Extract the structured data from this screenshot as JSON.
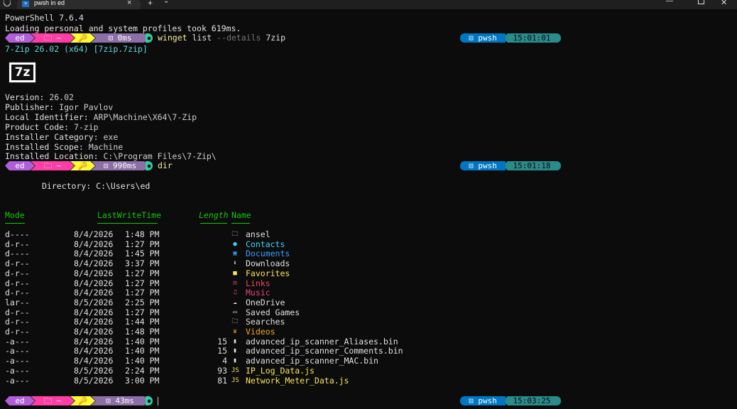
{
  "window": {
    "tab_title": "pwsh in ed",
    "tab_icon": "powershell-icon",
    "close_glyph": "×",
    "new_tab_glyph": "+",
    "dropdown_glyph": "⌄",
    "minimize_glyph": "—",
    "close_window_glyph": "✕"
  },
  "banner": {
    "version_line": "PowerShell 7.6.4",
    "profile_line": "Loading personal and system profiles took 619ms."
  },
  "prompts": [
    {
      "user": "ed",
      "path": "🗀 ~",
      "git": "🔑",
      "duration": "⊡ 0ms",
      "end_glyph": "●",
      "command_name": "winget",
      "command_args": " list ",
      "command_flag": "--details",
      "command_value": " 7zip",
      "shell": "⊡ pwsh",
      "clock": "15:01:01"
    },
    {
      "user": "ed",
      "path": "🗀 ~",
      "git": "🔑",
      "duration": "⊡ 990ms",
      "end_glyph": "●",
      "command_name": "dir",
      "command_args": "",
      "command_flag": "",
      "command_value": "",
      "shell": "⊡ pwsh",
      "clock": "15:01:18"
    },
    {
      "user": "ed",
      "path": "🗀 ~",
      "git": "🔑",
      "duration": "⊡ 43ms",
      "end_glyph": "●",
      "command_name": "",
      "command_args": "",
      "command_flag": "",
      "command_value": "",
      "shell": "⊡ pwsh",
      "clock": "15:03:25"
    }
  ],
  "winget": {
    "package_line": "7-Zip 26.02 (x64) [7zip.7zip]",
    "logo_text": "7z",
    "details": [
      {
        "key": "Version:",
        "value": " 26.02"
      },
      {
        "key": "Publisher:",
        "value": " Igor Pavlov"
      },
      {
        "key": "Local Identifier:",
        "value": " ARP\\Machine\\X64\\7-Zip"
      },
      {
        "key": "Product Code:",
        "value": " 7-zip"
      },
      {
        "key": "Installer Category:",
        "value": " exe"
      },
      {
        "key": "Installed Scope:",
        "value": " Machine"
      },
      {
        "key": "Installed Location:",
        "value": " C:\\Program Files\\7-Zip\\"
      }
    ]
  },
  "dir": {
    "directory_line": "Directory: C:\\Users\\ed",
    "headers": {
      "mode": "Mode",
      "lastwrite": "LastWriteTime",
      "length": "Length",
      "name": "Name"
    },
    "rows": [
      {
        "mode": "d----",
        "date": "8/4/2026",
        "time": "1:48 PM",
        "length": "",
        "icon": "🗀",
        "name": "ansel",
        "color": "#e0e0e0"
      },
      {
        "mode": "d-r--",
        "date": "8/4/2026",
        "time": "1:27 PM",
        "length": "",
        "icon": "●",
        "name": "Contacts",
        "color": "#3ad6f0"
      },
      {
        "mode": "d----",
        "date": "8/4/2026",
        "time": "1:45 PM",
        "length": "",
        "icon": "▣",
        "name": "Documents",
        "color": "#3b9cff"
      },
      {
        "mode": "d-r--",
        "date": "8/4/2026",
        "time": "3:37 PM",
        "length": "",
        "icon": "⬇",
        "name": "Downloads",
        "color": "#e0e0e0"
      },
      {
        "mode": "d-r--",
        "date": "8/4/2026",
        "time": "1:27 PM",
        "length": "",
        "icon": "■",
        "name": "Favorites",
        "color": "#f9e55a"
      },
      {
        "mode": "d-r--",
        "date": "8/4/2026",
        "time": "1:27 PM",
        "length": "",
        "icon": "⊡",
        "name": "Links",
        "color": "#e74856"
      },
      {
        "mode": "d-r--",
        "date": "8/4/2026",
        "time": "1:27 PM",
        "length": "",
        "icon": "♫",
        "name": "Music",
        "color": "#e8457d"
      },
      {
        "mode": "lar--",
        "date": "8/5/2026",
        "time": "2:25 PM",
        "length": "",
        "icon": "☁",
        "name": "OneDrive",
        "color": "#e0e0e0"
      },
      {
        "mode": "d-r--",
        "date": "8/4/2026",
        "time": "1:27 PM",
        "length": "",
        "icon": "▭",
        "name": "Saved Games",
        "color": "#e0e0e0"
      },
      {
        "mode": "d-r--",
        "date": "8/4/2026",
        "time": "1:44 PM",
        "length": "",
        "icon": "🗀",
        "name": "Searches",
        "color": "#e0e0e0"
      },
      {
        "mode": "d-r--",
        "date": "8/4/2026",
        "time": "1:48 PM",
        "length": "",
        "icon": "♛",
        "name": "Videos",
        "color": "#f5a623"
      },
      {
        "mode": "-a---",
        "date": "8/4/2026",
        "time": "1:40 PM",
        "length": "15",
        "icon": "▮",
        "name": "advanced_ip_scanner_Aliases.bin",
        "color": "#e0e0e0"
      },
      {
        "mode": "-a---",
        "date": "8/4/2026",
        "time": "1:40 PM",
        "length": "15",
        "icon": "▮",
        "name": "advanced_ip_scanner_Comments.bin",
        "color": "#e0e0e0"
      },
      {
        "mode": "-a---",
        "date": "8/4/2026",
        "time": "1:40 PM",
        "length": "4",
        "icon": "▮",
        "name": "advanced_ip_scanner_MAC.bin",
        "color": "#e0e0e0"
      },
      {
        "mode": "-a---",
        "date": "8/5/2026",
        "time": "2:24 PM",
        "length": "93",
        "icon": "JS",
        "name": "IP_Log_Data.js",
        "color": "#f9e55a"
      },
      {
        "mode": "-a---",
        "date": "8/5/2026",
        "time": "3:00 PM",
        "length": "81",
        "icon": "JS",
        "name": "Network_Meter_Data.js",
        "color": "#f9e55a"
      }
    ]
  }
}
